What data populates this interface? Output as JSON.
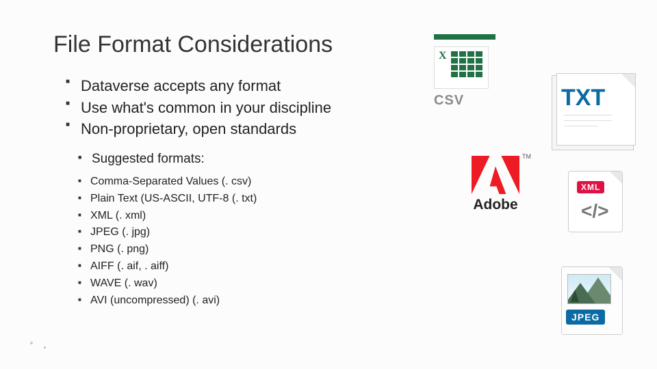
{
  "title": "File Format Considerations",
  "bullets": {
    "level1": [
      "Dataverse accepts any format",
      "Use what's common in your discipline",
      "Non-proprietary, open standards"
    ],
    "sub_heading": "Suggested formats:",
    "formats": [
      "Comma-Separated Values (. csv)",
      "Plain Text (US-ASCII, UTF-8 (. txt)",
      "XML (. xml)",
      "JPEG (. jpg)",
      "PNG (. png)",
      "AIFF (. aif, . aiff)",
      "WAVE (. wav)",
      "AVI (uncompressed) (. avi)"
    ]
  },
  "icons": {
    "csv_label": "CSV",
    "txt_label": "TXT",
    "adobe_label": "Adobe",
    "adobe_tm": "TM",
    "xml_badge": "XML",
    "xml_code": "</>",
    "jpeg_badge": "JPEG"
  }
}
